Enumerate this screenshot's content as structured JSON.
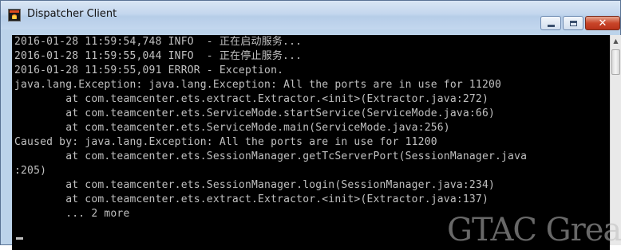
{
  "window": {
    "title": "Dispatcher Client",
    "icon": "console-app-icon",
    "buttons": {
      "minimize": "minimize-icon",
      "maximize": "maximize-icon",
      "close": "close-icon"
    }
  },
  "console": {
    "lines": [
      "2016-01-28 11:59:54,748 INFO  - 正在启动服务...",
      "2016-01-28 11:59:55,044 INFO  - 正在停止服务...",
      "2016-01-28 11:59:55,091 ERROR - Exception.",
      "java.lang.Exception: java.lang.Exception: All the ports are in use for 11200",
      "        at com.teamcenter.ets.extract.Extractor.<init>(Extractor.java:272)",
      "        at com.teamcenter.ets.ServiceMode.startService(ServiceMode.java:66)",
      "        at com.teamcenter.ets.ServiceMode.main(ServiceMode.java:256)",
      "Caused by: java.lang.Exception: All the ports are in use for 11200",
      "        at com.teamcenter.ets.SessionManager.getTcServerPort(SessionManager.java",
      ":205)",
      "        at com.teamcenter.ets.SessionManager.login(SessionManager.java:234)",
      "        at com.teamcenter.ets.extract.Extractor.<init>(Extractor.java:137)",
      "        ... 2 more"
    ]
  },
  "watermark": "GTAC Great",
  "colors": {
    "console_bg": "#000000",
    "console_text": "#c0c0c0",
    "titlebar": "#c4d7ee",
    "close_button": "#c9462a"
  }
}
